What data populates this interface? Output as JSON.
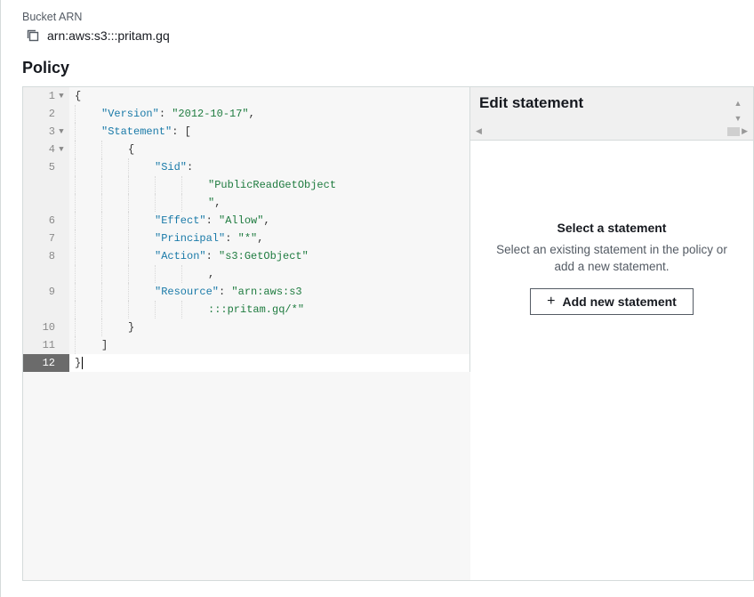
{
  "bucket_arn": {
    "label": "Bucket ARN",
    "value": "arn:aws:s3:::pritam.gq"
  },
  "policy": {
    "title": "Policy",
    "code_lines": [
      {
        "n": 1,
        "fold": true,
        "active": false,
        "ind": 0,
        "tokens": [
          [
            "pun",
            "{"
          ]
        ]
      },
      {
        "n": 2,
        "fold": false,
        "active": false,
        "ind": 1,
        "tokens": [
          [
            "key",
            "\"Version\""
          ],
          [
            "pun",
            ": "
          ],
          [
            "str",
            "\"2012-10-17\""
          ],
          [
            "pun",
            ","
          ]
        ]
      },
      {
        "n": 3,
        "fold": true,
        "active": false,
        "ind": 1,
        "tokens": [
          [
            "key",
            "\"Statement\""
          ],
          [
            "pun",
            ": ["
          ]
        ]
      },
      {
        "n": 4,
        "fold": true,
        "active": false,
        "ind": 2,
        "tokens": [
          [
            "pun",
            "{"
          ]
        ]
      },
      {
        "n": 5,
        "fold": false,
        "active": false,
        "ind": 3,
        "tokens": [
          [
            "key",
            "\"Sid\""
          ],
          [
            "pun",
            ": "
          ]
        ],
        "cont": [
          {
            "ind": 5,
            "tokens": [
              [
                "str",
                "\"PublicReadGetObject"
              ]
            ]
          },
          {
            "ind": 5,
            "tokens": [
              [
                "str",
                "\""
              ],
              [
                "pun",
                ","
              ]
            ]
          }
        ]
      },
      {
        "n": 6,
        "fold": false,
        "active": false,
        "ind": 3,
        "tokens": [
          [
            "key",
            "\"Effect\""
          ],
          [
            "pun",
            ": "
          ],
          [
            "str",
            "\"Allow\""
          ],
          [
            "pun",
            ","
          ]
        ]
      },
      {
        "n": 7,
        "fold": false,
        "active": false,
        "ind": 3,
        "tokens": [
          [
            "key",
            "\"Principal\""
          ],
          [
            "pun",
            ": "
          ],
          [
            "str",
            "\"*\""
          ],
          [
            "pun",
            ","
          ]
        ]
      },
      {
        "n": 8,
        "fold": false,
        "active": false,
        "ind": 3,
        "tokens": [
          [
            "key",
            "\"Action\""
          ],
          [
            "pun",
            ": "
          ],
          [
            "str",
            "\"s3:GetObject\""
          ]
        ],
        "cont": [
          {
            "ind": 5,
            "tokens": [
              [
                "pun",
                ","
              ]
            ]
          }
        ]
      },
      {
        "n": 9,
        "fold": false,
        "active": false,
        "ind": 3,
        "tokens": [
          [
            "key",
            "\"Resource\""
          ],
          [
            "pun",
            ": "
          ],
          [
            "str",
            "\"arn:aws:s3"
          ]
        ],
        "cont": [
          {
            "ind": 5,
            "tokens": [
              [
                "str",
                ":::pritam.gq/*\""
              ]
            ]
          }
        ]
      },
      {
        "n": 10,
        "fold": false,
        "active": false,
        "ind": 2,
        "tokens": [
          [
            "pun",
            "}"
          ]
        ]
      },
      {
        "n": 11,
        "fold": false,
        "active": false,
        "ind": 1,
        "tokens": [
          [
            "pun",
            "]"
          ]
        ]
      },
      {
        "n": 12,
        "fold": false,
        "active": true,
        "ind": 0,
        "tokens": [
          [
            "pun",
            "}"
          ]
        ],
        "cursor": true
      }
    ]
  },
  "side": {
    "header_title": "Edit statement",
    "select_title": "Select a statement",
    "select_desc": "Select an existing statement in the policy or add a new statement.",
    "add_label": "Add new statement"
  }
}
